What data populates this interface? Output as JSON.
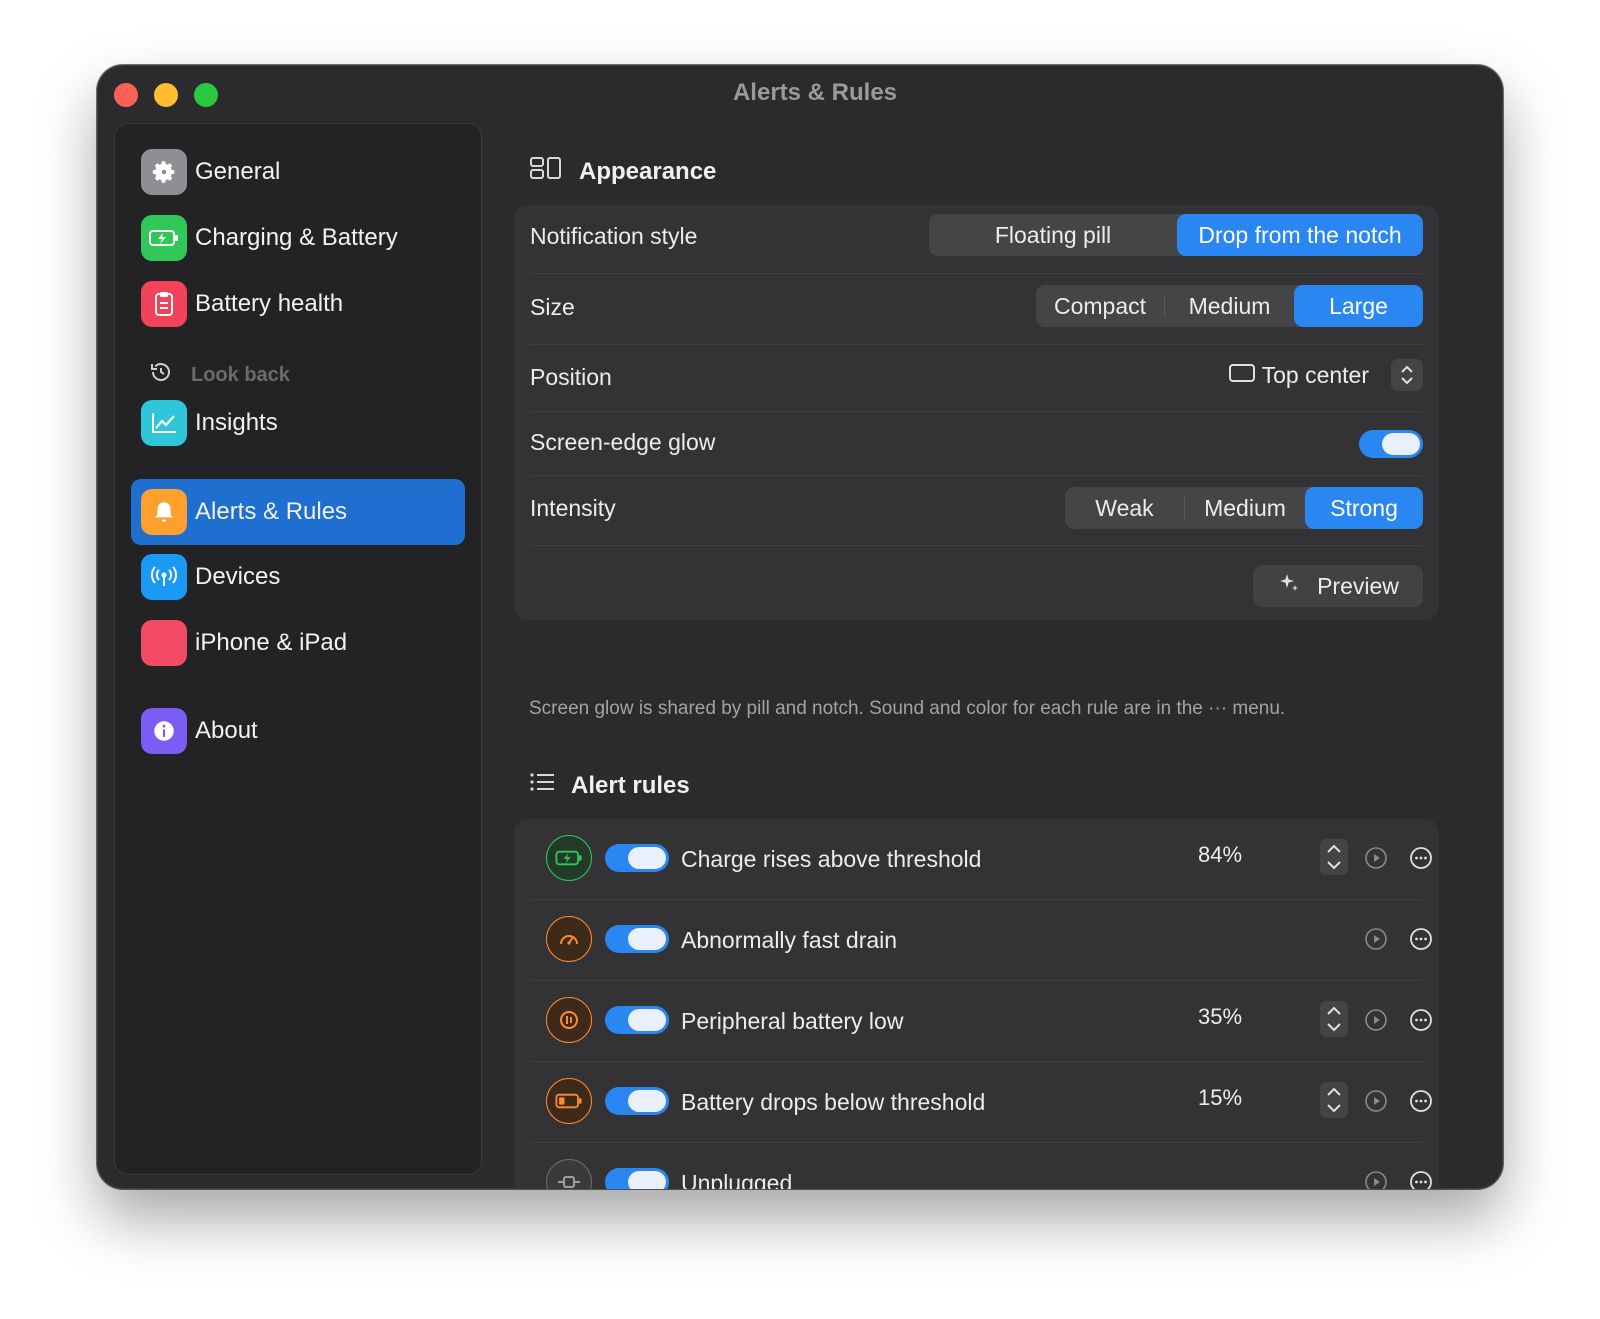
{
  "window": {
    "title": "Alerts & Rules"
  },
  "sidebar": {
    "items": [
      {
        "label": "General",
        "icon": "gear-icon",
        "color": "#8e8e93"
      },
      {
        "label": "Charging & Battery",
        "icon": "battery-charging-icon",
        "color": "#32c759"
      },
      {
        "label": "Battery health",
        "icon": "clipboard-icon",
        "color": "#f2435a"
      },
      {
        "label": "Insights",
        "icon": "chart-icon",
        "color": "#2fc6d9"
      },
      {
        "label": "Alerts & Rules",
        "icon": "bell-icon",
        "color": "#ff9f2e"
      },
      {
        "label": "Devices",
        "icon": "antenna-icon",
        "color": "#1a9af5"
      },
      {
        "label": "iPhone & iPad",
        "icon": "",
        "color": "#f24b63"
      },
      {
        "label": "About",
        "icon": "info-icon",
        "color": "#7b5cf5"
      }
    ],
    "section_lookback": "Look back",
    "active": "Alerts & Rules"
  },
  "appearance": {
    "title": "Appearance",
    "notification_style": {
      "label": "Notification style",
      "options": [
        "Floating pill",
        "Drop from the notch"
      ],
      "selected": "Drop from the notch"
    },
    "size": {
      "label": "Size",
      "options": [
        "Compact",
        "Medium",
        "Large"
      ],
      "selected": "Large"
    },
    "position": {
      "label": "Position",
      "value": "Top center"
    },
    "glow": {
      "label": "Screen-edge glow",
      "on": true
    },
    "intensity": {
      "label": "Intensity",
      "options": [
        "Weak",
        "Medium",
        "Strong"
      ],
      "selected": "Strong"
    },
    "preview_label": "Preview",
    "footnote": "Screen glow is shared by pill and notch. Sound and color for each rule are in the ··· menu."
  },
  "alert_rules": {
    "title": "Alert rules",
    "rules": [
      {
        "label": "Charge rises above threshold",
        "value": "84%",
        "enabled": true,
        "icon": "battery-charging-icon",
        "color": "#32c759"
      },
      {
        "label": "Abnormally fast drain",
        "value": "",
        "enabled": true,
        "icon": "speedometer-icon",
        "color": "#ff8a2e"
      },
      {
        "label": "Peripheral battery low",
        "value": "35%",
        "enabled": true,
        "icon": "waves-icon",
        "color": "#ff8a2e"
      },
      {
        "label": "Battery drops below threshold",
        "value": "15%",
        "enabled": true,
        "icon": "battery-low-icon",
        "color": "#ff8a2e"
      },
      {
        "label": "Unplugged",
        "value": "",
        "enabled": true,
        "icon": "plug-icon",
        "color": "#8e8e93"
      }
    ]
  },
  "colors": {
    "accent": "#2a86f0",
    "sidebar_active": "#1f6fd0"
  }
}
